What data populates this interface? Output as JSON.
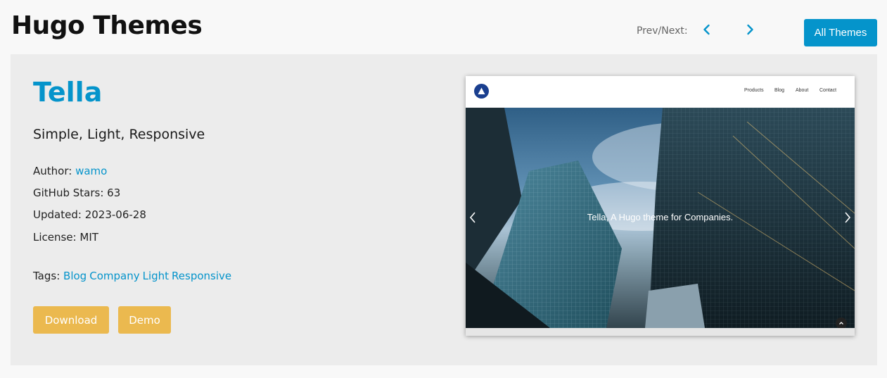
{
  "header": {
    "title": "Hugo Themes",
    "prevnext_label": "Prev/Next:",
    "all_themes_label": "All Themes"
  },
  "theme": {
    "name": "Tella",
    "tagline": "Simple, Light, Responsive",
    "author_label": "Author:",
    "author": "wamo",
    "stars_label": "GitHub Stars:",
    "stars": "63",
    "updated_label": "Updated:",
    "updated": "2023-06-28",
    "license_label": "License:",
    "license": "MIT",
    "tags_label": "Tags:",
    "tags": [
      "Blog",
      "Company",
      "Light",
      "Responsive"
    ],
    "download_label": "Download",
    "demo_label": "Demo"
  },
  "preview": {
    "menu": [
      "Products",
      "Blog",
      "About",
      "Contact"
    ],
    "caption": "Tella, A Hugo theme for Companies."
  },
  "colors": {
    "accent": "#0594cb",
    "button_yellow": "#ebb94f",
    "panel_bg": "#ececec",
    "page_bg": "#f8f8f8"
  }
}
